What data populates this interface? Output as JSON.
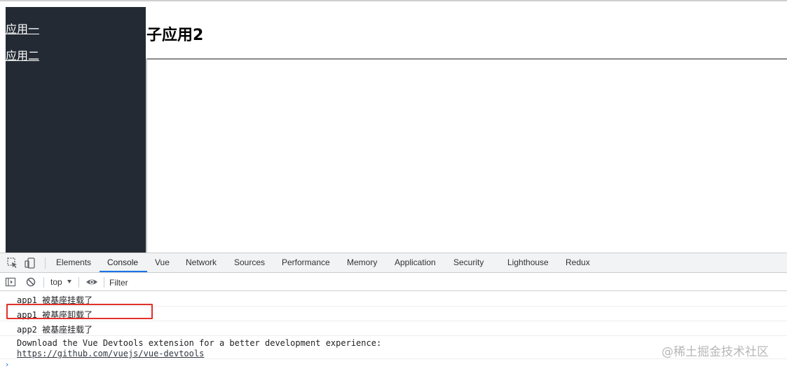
{
  "app": {
    "nav": [
      "应用一",
      "应用二"
    ],
    "title": "子应用2"
  },
  "devtools": {
    "tabs": [
      "Elements",
      "Console",
      "Vue",
      "Network",
      "Sources",
      "Performance",
      "Memory",
      "Application",
      "Security",
      "Lighthouse",
      "Redux"
    ],
    "active_tab": "Console",
    "context": "top",
    "filter_placeholder": "Filter",
    "messages": [
      "app1 被基座挂载了",
      "app1 被基座卸载了",
      "app2 被基座挂载了"
    ],
    "extension_message": {
      "line1": "Download the Vue Devtools extension for a better development experience:",
      "link": "https://github.com/vuejs/vue-devtools"
    },
    "prompt": "›"
  },
  "watermark": "@稀土掘金技术社区",
  "colors": {
    "sidebar": "#232a33",
    "highlight": "#e0312b",
    "active_tab_underline": "#1a73e8"
  }
}
